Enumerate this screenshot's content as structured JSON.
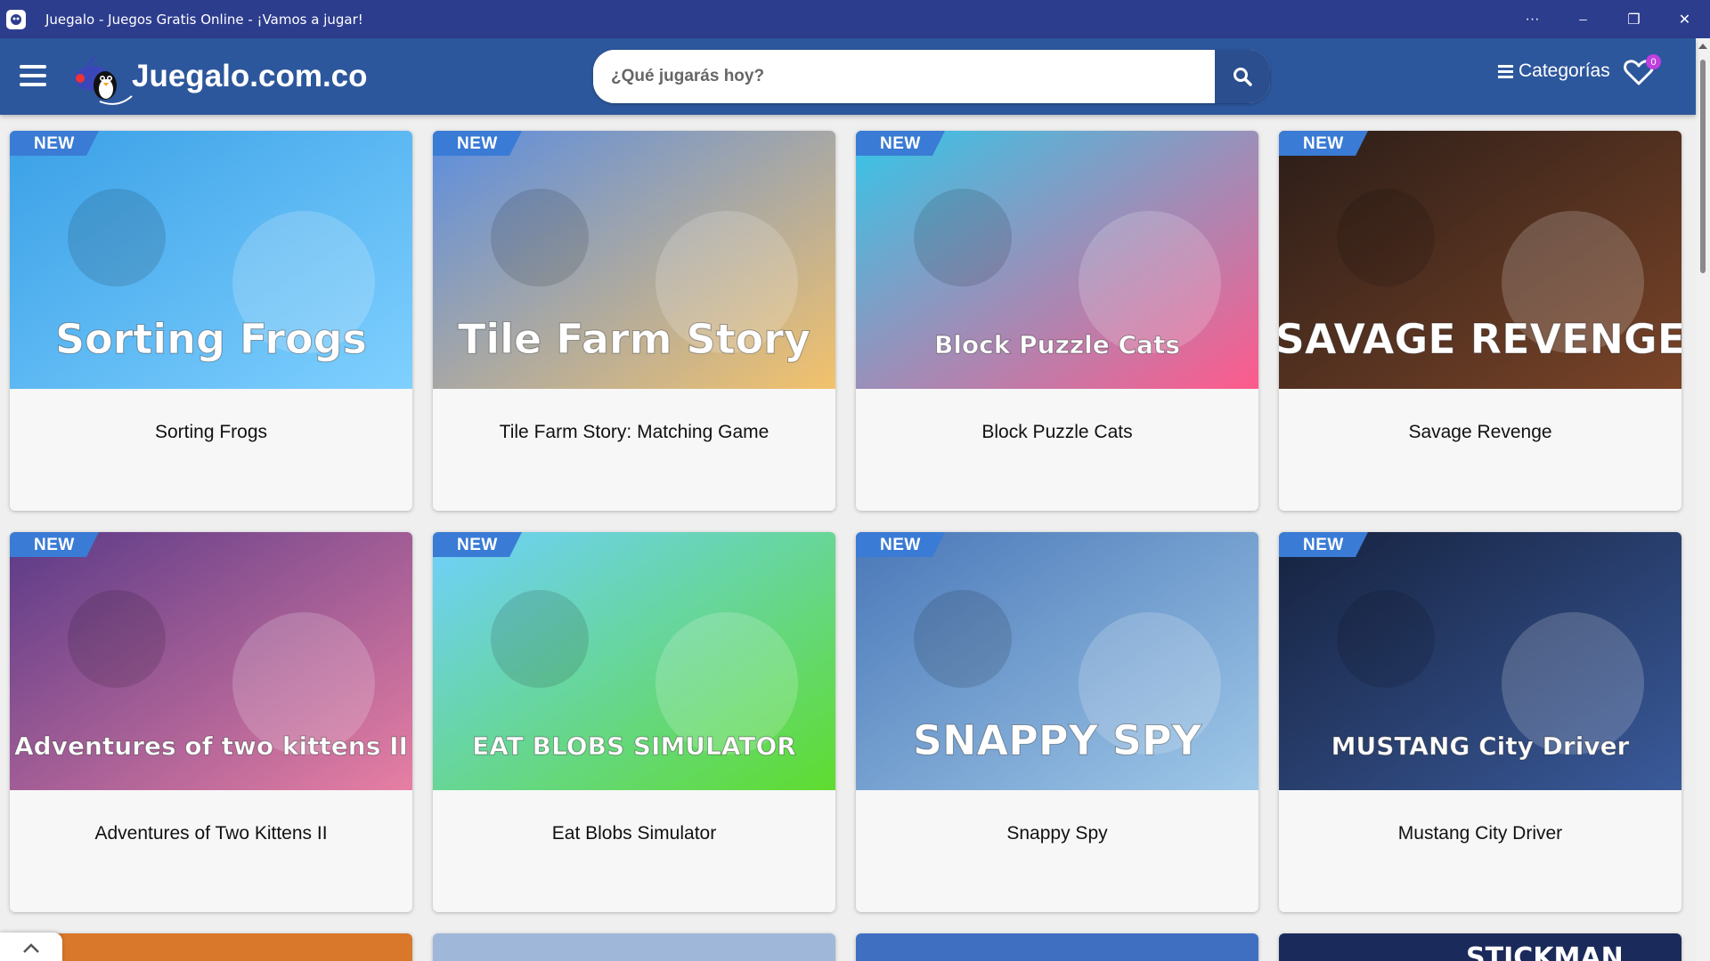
{
  "window": {
    "title": "Juegalo - Juegos Gratis Online - ¡Vamos a jugar!",
    "more_glyph": "···",
    "minimize_glyph": "─",
    "restore_glyph": "❐",
    "close_glyph": "✕"
  },
  "header": {
    "logo_text": "Juegalo.com.co",
    "search_placeholder": "¿Qué jugarás hoy?",
    "categories_label": "Categorías",
    "favorites_count": "0",
    "bg_color": "#2d579c"
  },
  "badge_label": "NEW",
  "games": [
    {
      "title": "Sorting Frogs",
      "art_text": "Sorting Frogs",
      "colors": [
        "#3aa0e6",
        "#7fd0ff"
      ]
    },
    {
      "title": "Tile Farm Story: Matching Game",
      "art_text": "Tile Farm Story",
      "colors": [
        "#5b8de0",
        "#f3c26b"
      ]
    },
    {
      "title": "Block Puzzle Cats",
      "art_text": "Block Puzzle Cats",
      "colors": [
        "#34c6e8",
        "#ff5a8c"
      ]
    },
    {
      "title": "Savage Revenge",
      "art_text": "SAVAGE REVENGE",
      "colors": [
        "#2b1d18",
        "#7a4428"
      ]
    },
    {
      "title": "Adventures of Two Kittens II",
      "art_text": "Adventures of two kittens II",
      "colors": [
        "#5a3a88",
        "#e77fa3"
      ]
    },
    {
      "title": "Eat Blobs Simulator",
      "art_text": "EAT BLOBS SIMULATOR",
      "colors": [
        "#6fd0ff",
        "#5fdc2f"
      ]
    },
    {
      "title": "Snappy Spy",
      "art_text": "SNAPPY SPY",
      "colors": [
        "#4a78b8",
        "#9fc8e8"
      ]
    },
    {
      "title": "Mustang City Driver",
      "art_text": "MUSTANG City Driver",
      "colors": [
        "#16223f",
        "#3a5a9a"
      ]
    }
  ],
  "partial_row_colors": [
    "#d9782a",
    "#9fb7d8",
    "#3f6fc0",
    "#1a2a5a"
  ],
  "partial_row_text": [
    "",
    "",
    "",
    "STICKMAN"
  ]
}
